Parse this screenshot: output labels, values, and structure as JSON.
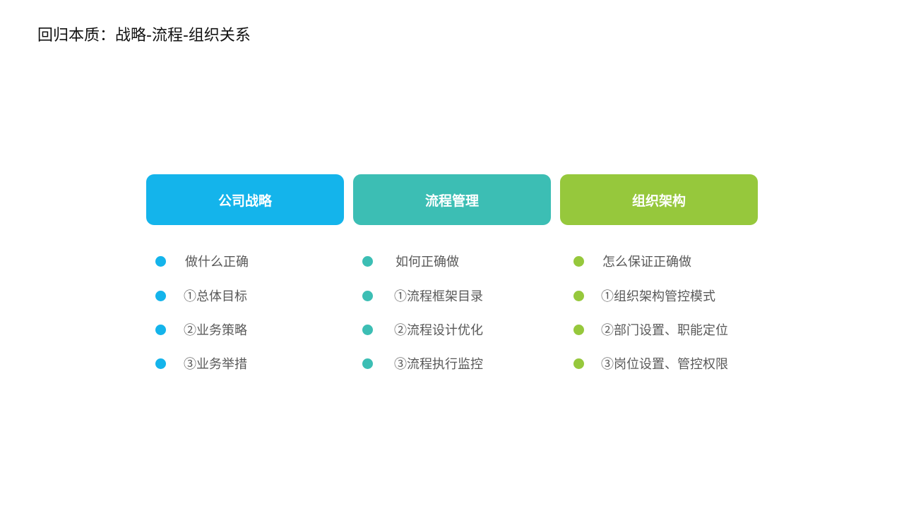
{
  "title": "回归本质：战略-流程-组织关系",
  "columns": [
    {
      "header": "公司战略",
      "color": "#14b4eb",
      "items": [
        "做什么正确",
        "①总体目标",
        "②业务策略",
        "③业务举措"
      ]
    },
    {
      "header": "流程管理",
      "color": "#3cbeb4",
      "items": [
        "如何正确做",
        "①流程框架目录",
        "②流程设计优化",
        "③流程执行监控"
      ]
    },
    {
      "header": "组织架构",
      "color": "#96c83c",
      "items": [
        "怎么保证正确做",
        "①组织架构管控模式",
        "②部门设置、职能定位",
        "③岗位设置、管控权限"
      ]
    }
  ]
}
